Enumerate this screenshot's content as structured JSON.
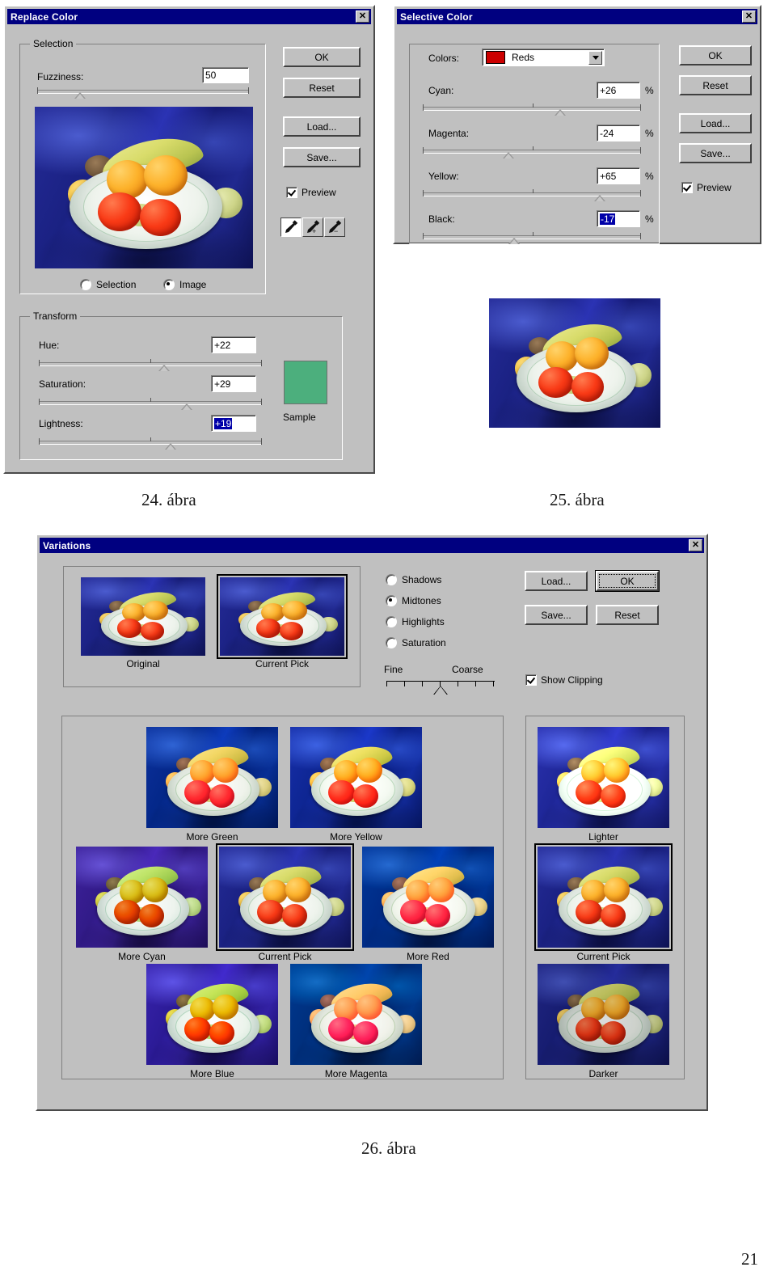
{
  "document": {
    "page_number": "21",
    "captions": [
      {
        "text": "24. ábra"
      },
      {
        "text": "25. ábra"
      },
      {
        "text": "26. ábra"
      }
    ]
  },
  "replace_color": {
    "title": "Replace Color",
    "close_label": "✕",
    "selection_group": {
      "label": "Selection"
    },
    "fuzziness": {
      "label": "Fuzziness:",
      "value": "50"
    },
    "preview_mode": {
      "selection_label": "Selection",
      "image_label": "Image",
      "selected": "Image"
    },
    "transform_group": {
      "label": "Transform"
    },
    "hue": {
      "label": "Hue:",
      "value": "+22"
    },
    "saturation": {
      "label": "Saturation:",
      "value": "+29"
    },
    "lightness": {
      "label": "Lightness:",
      "value": "+19"
    },
    "sample": {
      "label": "Sample",
      "color": "#4caf7d"
    },
    "buttons": {
      "ok": "OK",
      "reset": "Reset",
      "load": "Load...",
      "save": "Save..."
    },
    "preview_checkbox": {
      "label": "Preview",
      "checked": true
    },
    "eyedroppers": [
      {
        "name": "eyedropper",
        "active": true
      },
      {
        "name": "eyedropper-add",
        "active": false
      },
      {
        "name": "eyedropper-subtract",
        "active": false
      }
    ]
  },
  "selective_color": {
    "title": "Selective Color",
    "close_label": "✕",
    "colors": {
      "label": "Colors:",
      "value": "Reds",
      "swatch": "#cc0000"
    },
    "sliders": [
      {
        "label": "Cyan:",
        "value": "+26",
        "unit": "%",
        "selected": false
      },
      {
        "label": "Magenta:",
        "value": "-24",
        "unit": "%",
        "selected": false
      },
      {
        "label": "Yellow:",
        "value": "+65",
        "unit": "%",
        "selected": false
      },
      {
        "label": "Black:",
        "value": "-17",
        "unit": "%",
        "selected": true
      }
    ],
    "buttons": {
      "ok": "OK",
      "reset": "Reset",
      "load": "Load...",
      "save": "Save..."
    },
    "preview_checkbox": {
      "label": "Preview",
      "checked": true
    }
  },
  "variations": {
    "title": "Variations",
    "close_label": "✕",
    "top_thumbs": [
      {
        "caption": "Original"
      },
      {
        "caption": "Current Pick",
        "selected": true
      }
    ],
    "tone_radios": [
      {
        "label": "Shadows",
        "selected": false
      },
      {
        "label": "Midtones",
        "selected": true
      },
      {
        "label": "Highlights",
        "selected": false
      },
      {
        "label": "Saturation",
        "selected": false
      }
    ],
    "fine_coarse": {
      "fine_label": "Fine",
      "coarse_label": "Coarse",
      "position": 4,
      "ticks": 7
    },
    "buttons": {
      "load": "Load...",
      "save": "Save...",
      "ok": "OK",
      "reset": "Reset"
    },
    "show_clipping": {
      "label": "Show Clipping",
      "checked": true
    },
    "color_grid": [
      {
        "caption": "More Green",
        "tint": "t-green",
        "selected": false
      },
      {
        "caption": "More Yellow",
        "tint": "t-yellow",
        "selected": false
      },
      {
        "caption": "More Cyan",
        "tint": "t-cyan",
        "selected": false
      },
      {
        "caption": "Current Pick",
        "tint": "",
        "selected": true
      },
      {
        "caption": "More Red",
        "tint": "t-red",
        "selected": false
      },
      {
        "caption": "More Blue",
        "tint": "t-blue",
        "selected": false
      },
      {
        "caption": "More Magenta",
        "tint": "t-magenta",
        "selected": false
      }
    ],
    "lightness_column": [
      {
        "caption": "Lighter",
        "tint": "t-lighter",
        "selected": false
      },
      {
        "caption": "Current Pick",
        "tint": "",
        "selected": true
      },
      {
        "caption": "Darker",
        "tint": "t-darker",
        "selected": false
      }
    ]
  }
}
